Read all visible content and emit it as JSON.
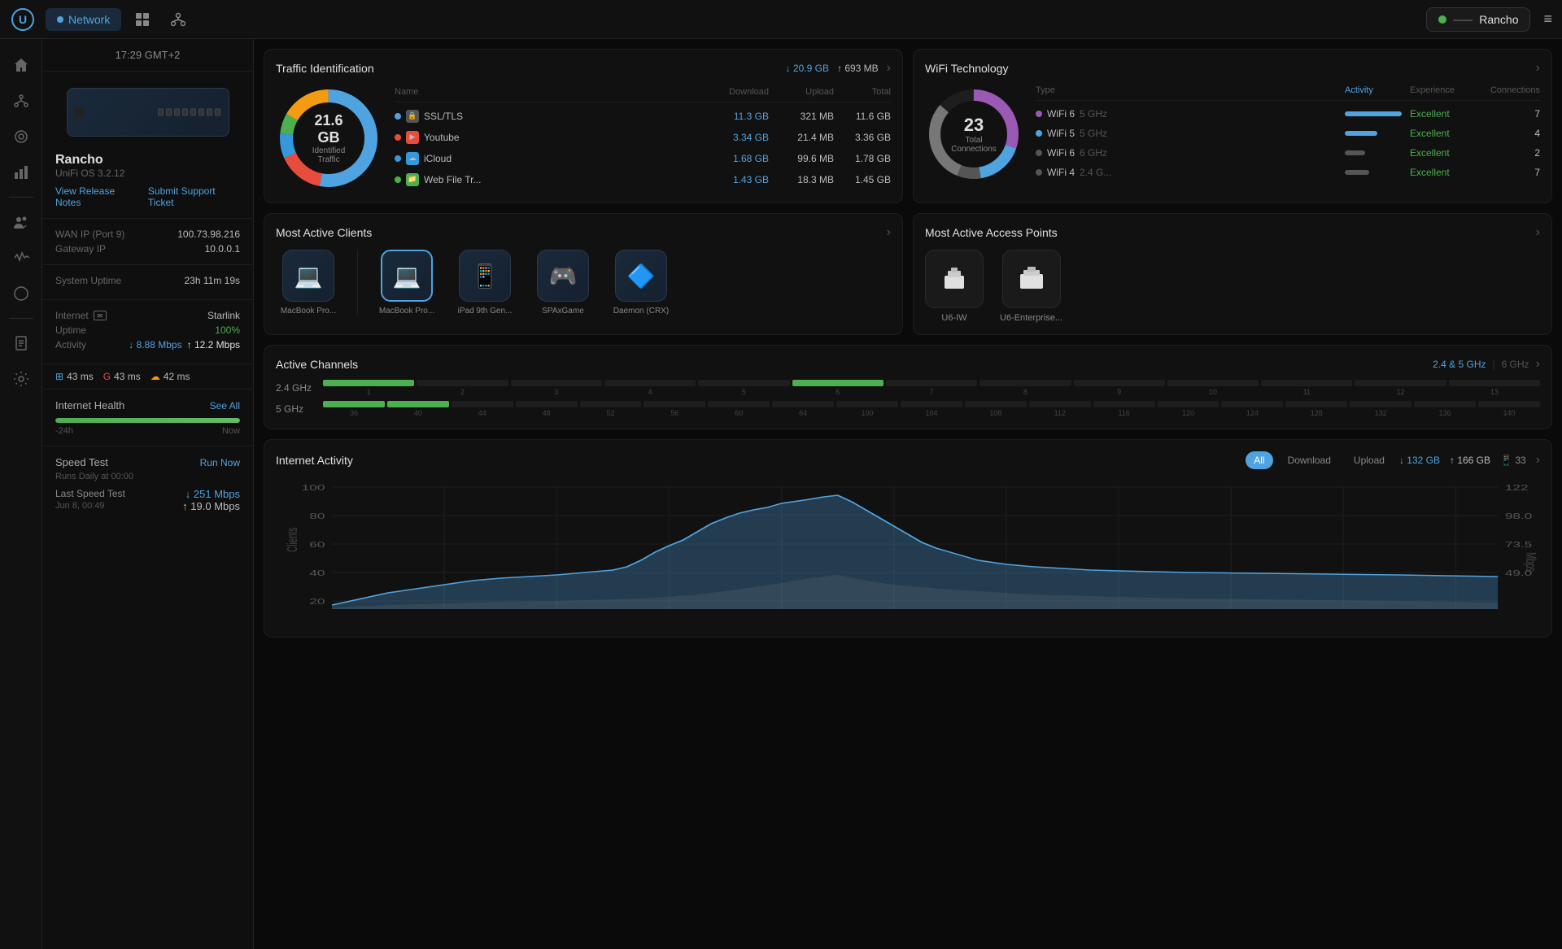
{
  "app": {
    "logo": "U"
  },
  "topnav": {
    "tabs": [
      {
        "id": "network",
        "label": "Network",
        "active": true
      },
      {
        "id": "grid",
        "label": "",
        "active": false
      },
      {
        "id": "topology",
        "label": "",
        "active": false
      }
    ],
    "site_status": "online",
    "site_name": "Rancho",
    "more_icon": "≡"
  },
  "sidebar": {
    "icons": [
      {
        "id": "home",
        "symbol": "⌂",
        "active": false
      },
      {
        "id": "share",
        "symbol": "⛶",
        "active": false
      },
      {
        "id": "eye",
        "symbol": "◎",
        "active": false
      },
      {
        "id": "list",
        "symbol": "☰",
        "active": false
      },
      {
        "id": "users",
        "symbol": "👥",
        "active": false
      },
      {
        "id": "activity",
        "symbol": "〜",
        "active": false
      },
      {
        "id": "circle",
        "symbol": "○",
        "active": false
      },
      {
        "id": "document",
        "symbol": "📄",
        "active": false
      },
      {
        "id": "settings",
        "symbol": "⚙",
        "active": false
      }
    ]
  },
  "device_panel": {
    "time": "17:29 GMT+2",
    "device_name": "Rancho",
    "device_os": "UniFi OS 3.2.12",
    "links": [
      "View Release Notes",
      "Submit Support Ticket"
    ],
    "wan_ip_label": "WAN IP (Port 9)",
    "wan_ip_value": "100.73.98.216",
    "gateway_ip_label": "Gateway IP",
    "gateway_ip_value": "10.0.0.1",
    "system_uptime_label": "System Uptime",
    "system_uptime_value": "23h 11m 19s",
    "internet_label": "Internet",
    "internet_provider": "Starlink",
    "uptime_label": "Uptime",
    "uptime_value": "100%",
    "activity_down": "8.88 Mbps",
    "activity_up": "12.2 Mbps",
    "pings": [
      {
        "icon": "win",
        "value": "43 ms"
      },
      {
        "icon": "goog",
        "value": "43 ms"
      },
      {
        "icon": "cloud",
        "value": "42 ms"
      }
    ],
    "internet_health_label": "Internet Health",
    "see_all": "See All",
    "time_start": "-24h",
    "time_end": "Now",
    "speed_test_label": "Speed Test",
    "run_now": "Run Now",
    "runs_daily": "Runs Daily at 00:00",
    "last_speed_test_label": "Last Speed Test",
    "last_speed_date": "Jun 8, 00:49",
    "last_speed_down": "251 Mbps",
    "last_speed_up": "19.0 Mbps"
  },
  "traffic": {
    "title": "Traffic Identification",
    "total_down": "20.9 GB",
    "total_up": "693 MB",
    "donut_center": "21.6 GB",
    "donut_label": "Identified Traffic",
    "columns": [
      "Name",
      "Download",
      "Upload",
      "Total"
    ],
    "rows": [
      {
        "dot_color": "#4fa3e0",
        "app_color": "#666",
        "name": "SSL/TLS",
        "download": "11.3 GB",
        "upload": "321 MB",
        "total": "11.6 GB"
      },
      {
        "dot_color": "#e74c3c",
        "app_color": "#e74c3c",
        "name": "Youtube",
        "download": "3.34 GB",
        "upload": "21.4 MB",
        "total": "3.36 GB"
      },
      {
        "dot_color": "#3498db",
        "app_color": "#3498db",
        "name": "iCloud",
        "download": "1.68 GB",
        "upload": "99.6 MB",
        "total": "1.78 GB"
      },
      {
        "dot_color": "#4caf50",
        "app_color": "#4caf50",
        "name": "Web File Tr...",
        "download": "1.43 GB",
        "upload": "18.3 MB",
        "total": "1.45 GB"
      }
    ]
  },
  "wifi": {
    "title": "WiFi Technology",
    "total_connections": "23",
    "total_label": "Total Connections",
    "columns": [
      "Type",
      "Activity",
      "Experience",
      "Connections"
    ],
    "rows": [
      {
        "dot_color": "#9b59b6",
        "type": "WiFi 6",
        "band": "5 GHz",
        "activity_width": 70,
        "experience": "Excellent",
        "connections": 7
      },
      {
        "dot_color": "#4fa3e0",
        "type": "WiFi 5",
        "band": "5 GHz",
        "activity_width": 35,
        "experience": "Excellent",
        "connections": 4
      },
      {
        "dot_color": "#555",
        "type": "WiFi 6",
        "band": "6 GHz",
        "activity_width": 20,
        "experience": "Excellent",
        "connections": 2
      },
      {
        "dot_color": "#555",
        "type": "WiFi 4",
        "band": "2.4 G...",
        "activity_width": 25,
        "experience": "Excellent",
        "connections": 7
      }
    ]
  },
  "clients": {
    "title": "Most Active Clients",
    "items": [
      {
        "name": "MacBook Pro...",
        "icon": "💻",
        "selected": false
      },
      {
        "name": "MacBook Pro...",
        "icon": "💻",
        "selected": true
      },
      {
        "name": "iPad 9th Gen...",
        "icon": "📱",
        "selected": false
      },
      {
        "name": "SPAxGame",
        "icon": "🎮",
        "selected": false
      },
      {
        "name": "Daemon (CRX)",
        "icon": "🔷",
        "selected": false
      }
    ]
  },
  "access_points": {
    "title": "Most Active Access Points",
    "items": [
      {
        "name": "U6-IW",
        "icon": "📡"
      },
      {
        "name": "U6-Enterprise...",
        "icon": "📡"
      }
    ]
  },
  "channels": {
    "title": "Active Channels",
    "filters": [
      "2.4 & 5 GHz",
      "6 GHz"
    ],
    "active_filter": "2.4 & 5 GHz",
    "band_24": {
      "label": "2.4 GHz",
      "channels": [
        "1",
        "2",
        "3",
        "4",
        "5",
        "6",
        "7",
        "8",
        "9",
        "10",
        "11",
        "12",
        "13"
      ],
      "active": [
        1,
        6
      ]
    },
    "band_5": {
      "label": "5 GHz",
      "channels": [
        "36",
        "40",
        "44",
        "48",
        "52",
        "56",
        "60",
        "64",
        "100",
        "104",
        "108",
        "112",
        "116",
        "120",
        "124",
        "128",
        "132",
        "136",
        "140"
      ],
      "active": [
        36,
        40
      ]
    }
  },
  "activity": {
    "title": "Internet Activity",
    "filters": [
      "All",
      "Download",
      "Upload"
    ],
    "active_filter": "All",
    "total_down": "132 GB",
    "total_up": "166 GB",
    "device_count": "33",
    "y_labels_left": [
      "100",
      "80",
      "60",
      "40",
      "20"
    ],
    "y_labels_right": [
      "122",
      "98.0",
      "73.5",
      "49.0"
    ],
    "x_label_clients": "Clients",
    "x_label_mbps": "Mbps"
  }
}
